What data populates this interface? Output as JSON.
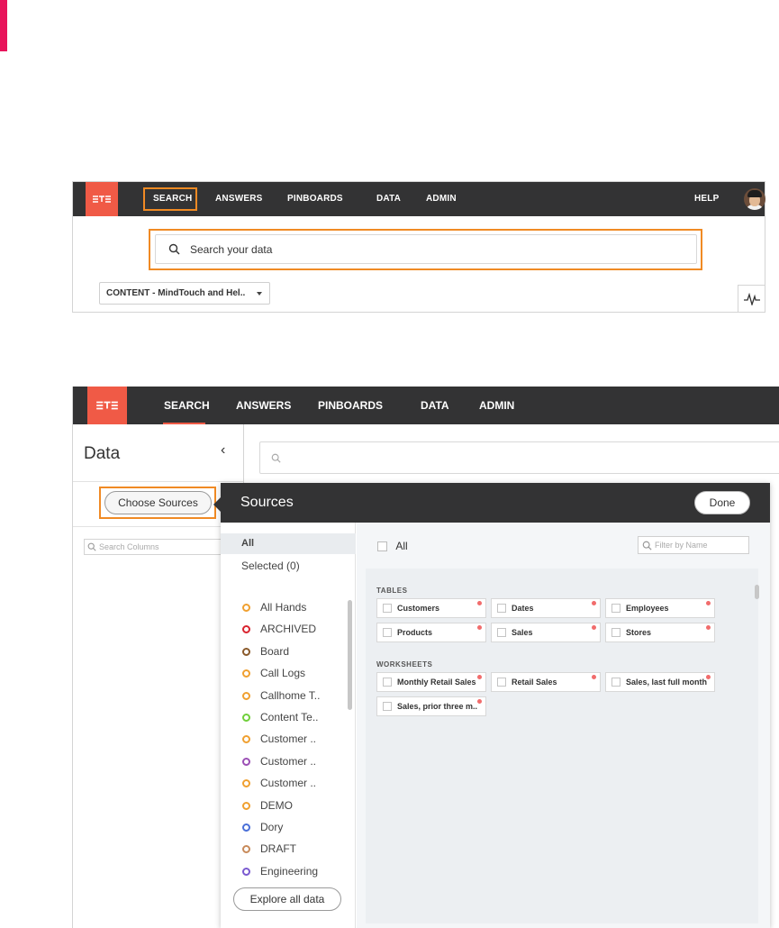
{
  "top_nav": {
    "items": [
      "SEARCH",
      "ANSWERS",
      "PINBOARDS",
      "DATA",
      "ADMIN"
    ],
    "help": "HELP"
  },
  "search_bar": {
    "placeholder": "Search your data"
  },
  "source_dropdown": {
    "selected": "CONTENT - MindTouch and Hel.."
  },
  "data_panel": {
    "title": "Data",
    "choose_sources": "Choose Sources",
    "search_columns_placeholder": "Search Columns"
  },
  "sources_dialog": {
    "title": "Sources",
    "done": "Done",
    "filter_all": "All",
    "filter_selected": "Selected (0)",
    "sources_list": [
      {
        "label": "All Hands",
        "color": "#f0a030"
      },
      {
        "label": "ARCHIVED",
        "color": "#d9232e"
      },
      {
        "label": "Board",
        "color": "#8a5a2b"
      },
      {
        "label": "Call Logs",
        "color": "#f0a030"
      },
      {
        "label": "Callhome T..",
        "color": "#f0a030"
      },
      {
        "label": "Content Te..",
        "color": "#6fcf3a"
      },
      {
        "label": "Customer ..",
        "color": "#f0a030"
      },
      {
        "label": "Customer ..",
        "color": "#9b4fb5"
      },
      {
        "label": "Customer ..",
        "color": "#f0a030"
      },
      {
        "label": "DEMO",
        "color": "#f0a030"
      },
      {
        "label": "Dory",
        "color": "#4a6fd8"
      },
      {
        "label": "DRAFT",
        "color": "#c88a5a"
      },
      {
        "label": "Engineering",
        "color": "#7a5ad0"
      }
    ],
    "explore_all": "Explore all data",
    "select_all_label": "All",
    "filter_placeholder": "Filter by Name",
    "tables_label": "TABLES",
    "tables": [
      "Customers",
      "Dates",
      "Employees",
      "Products",
      "Sales",
      "Stores"
    ],
    "worksheets_label": "WORKSHEETS",
    "worksheets": [
      "Monthly Retail Sales",
      "Retail Sales",
      "Sales, last full month",
      "Sales, prior three m.."
    ]
  }
}
